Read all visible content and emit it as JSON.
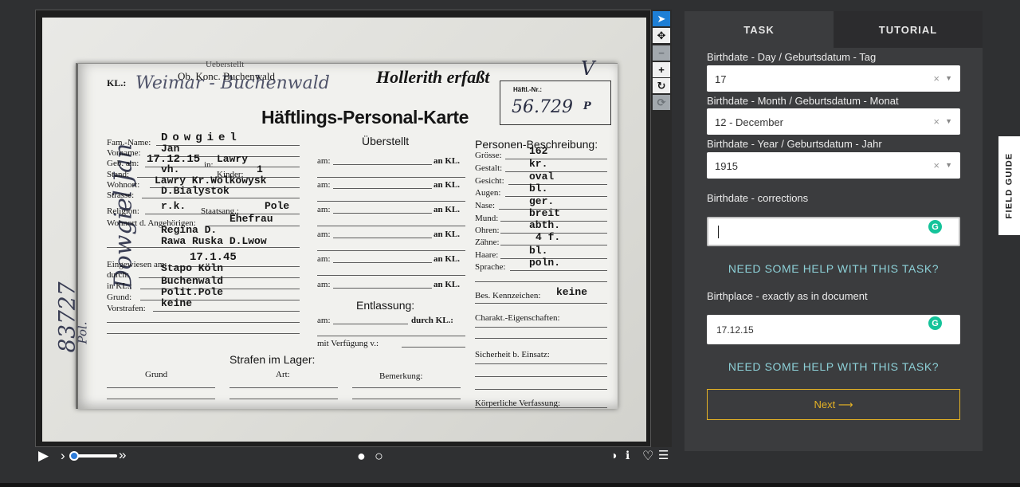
{
  "viewer": {
    "tools": [
      {
        "name": "pointer",
        "glyph": "➤"
      },
      {
        "name": "move",
        "glyph": "✥"
      },
      {
        "name": "zoom-out",
        "glyph": "−"
      },
      {
        "name": "zoom-in",
        "glyph": "+"
      },
      {
        "name": "rotate",
        "glyph": "↻"
      },
      {
        "name": "reset",
        "glyph": "⟳"
      }
    ],
    "play_glyph": "▶",
    "prev_glyph": "›",
    "next_glyph": "»",
    "frame_dots": [
      "●",
      "○"
    ],
    "icons": {
      "invert": "◑",
      "info": "ℹ",
      "favorite": "♡",
      "collections": "☰"
    }
  },
  "document": {
    "top_stamp": "Ueberstellt",
    "kl_label": "KL.:",
    "kl_value": "Ob. Konc. Buchenwald",
    "kl_handwritten": "Weimar - Buchenwald",
    "hollerith": "Hollerith erfaßt",
    "check_mark": "V",
    "haeftl_label": "Häftl.-Nr.:",
    "haeftl_nr": "56.729",
    "category_mark": "P",
    "title": "Häftlings-Personal-Karte",
    "margin_name": "Dowgiel Jan",
    "margin_number": "83727",
    "margin_tag": "Pol.",
    "fields": [
      {
        "label": "Fam.-Name:",
        "value": "Dowgiel"
      },
      {
        "label": "Vorname:",
        "value": "Jan"
      },
      {
        "label": "Geb. am:",
        "value": "17.12.15"
      },
      {
        "label": "in:",
        "value": "Lawry"
      },
      {
        "label": "Stand:",
        "value": "vh."
      },
      {
        "label": "Kinder:",
        "value": "1"
      },
      {
        "label": "Wohnort:",
        "value": "Lawry Kr.Wolkowysk"
      },
      {
        "label": "Strasse:",
        "value": "D.Bialystok"
      },
      {
        "label": "Religion:",
        "value": "r.k."
      },
      {
        "label": "Staatsang.:",
        "value": "Pole"
      },
      {
        "label": "Wohnort d. Angehörigen:",
        "value": "Ehefrau"
      },
      {
        "label": "",
        "value": "Regina D."
      },
      {
        "label": "",
        "value": "Rawa Ruska D.Lwow"
      },
      {
        "label": "Eingewiesen am:",
        "value": "17.1.45"
      },
      {
        "label": "durch:",
        "value": "Stapo Köln"
      },
      {
        "label": "in KL.:",
        "value": "Buchenwald"
      },
      {
        "label": "Grund:",
        "value": "Polit.Pole"
      },
      {
        "label": "Vorstrafen:",
        "value": "keine"
      }
    ],
    "ueberstellt_heading": "Überstellt",
    "am_label": "am:",
    "an_kl_label": "an KL.",
    "entlassung_heading": "Entlassung:",
    "durch_kl_label": "durch KL.:",
    "mit_verfuegung_label": "mit Verfügung v.:",
    "personen_heading": "Personen-Beschreibung:",
    "description": [
      {
        "label": "Grösse:",
        "value": "162"
      },
      {
        "label": "Gestalt:",
        "value": "kr."
      },
      {
        "label": "Gesicht:",
        "value": "oval"
      },
      {
        "label": "Augen:",
        "value": "bl."
      },
      {
        "label": "Nase:",
        "value": "ger."
      },
      {
        "label": "Mund:",
        "value": "breit"
      },
      {
        "label": "Ohren:",
        "value": "abth."
      },
      {
        "label": "Zähne:",
        "value": "4 f."
      },
      {
        "label": "Haare:",
        "value": "bl."
      },
      {
        "label": "Sprache:",
        "value": "poln."
      }
    ],
    "bes_kennzeichen_label": "Bes. Kennzeichen:",
    "bes_kennzeichen_value": "keine",
    "charakt_label": "Charakt.-Eigenschaften:",
    "sicherheit_label": "Sicherheit b. Einsatz:",
    "koerperliche_label": "Körperliche Verfassung:",
    "strafen_heading": "Strafen im Lager:",
    "grund_col": "Grund",
    "art_col": "Art:",
    "bemerkung_col": "Bemerkung:"
  },
  "panel": {
    "tabs": [
      "TASK",
      "TUTORIAL"
    ],
    "fields": {
      "day_label": "Birthdate - Day / Geburtsdatum - Tag",
      "day_value": "17",
      "month_label": "Birthdate - Month / Geburtsdatum - Monat",
      "month_value": "12 - December",
      "year_label": "Birthdate - Year / Geburtsdatum - Jahr",
      "year_value": "1915",
      "corrections_label": "Birthdate - corrections",
      "corrections_value": "",
      "birthplace_label": "Birthplace - exactly as in document",
      "birthplace_value": "17.12.15"
    },
    "clear_glyph": "×",
    "dropdown_glyph": "▼",
    "grammarly_glyph": "G",
    "help_text": "NEED SOME HELP WITH THIS TASK?",
    "next_label": "Next ⟶"
  },
  "field_guide_label": "FIELD GUIDE"
}
